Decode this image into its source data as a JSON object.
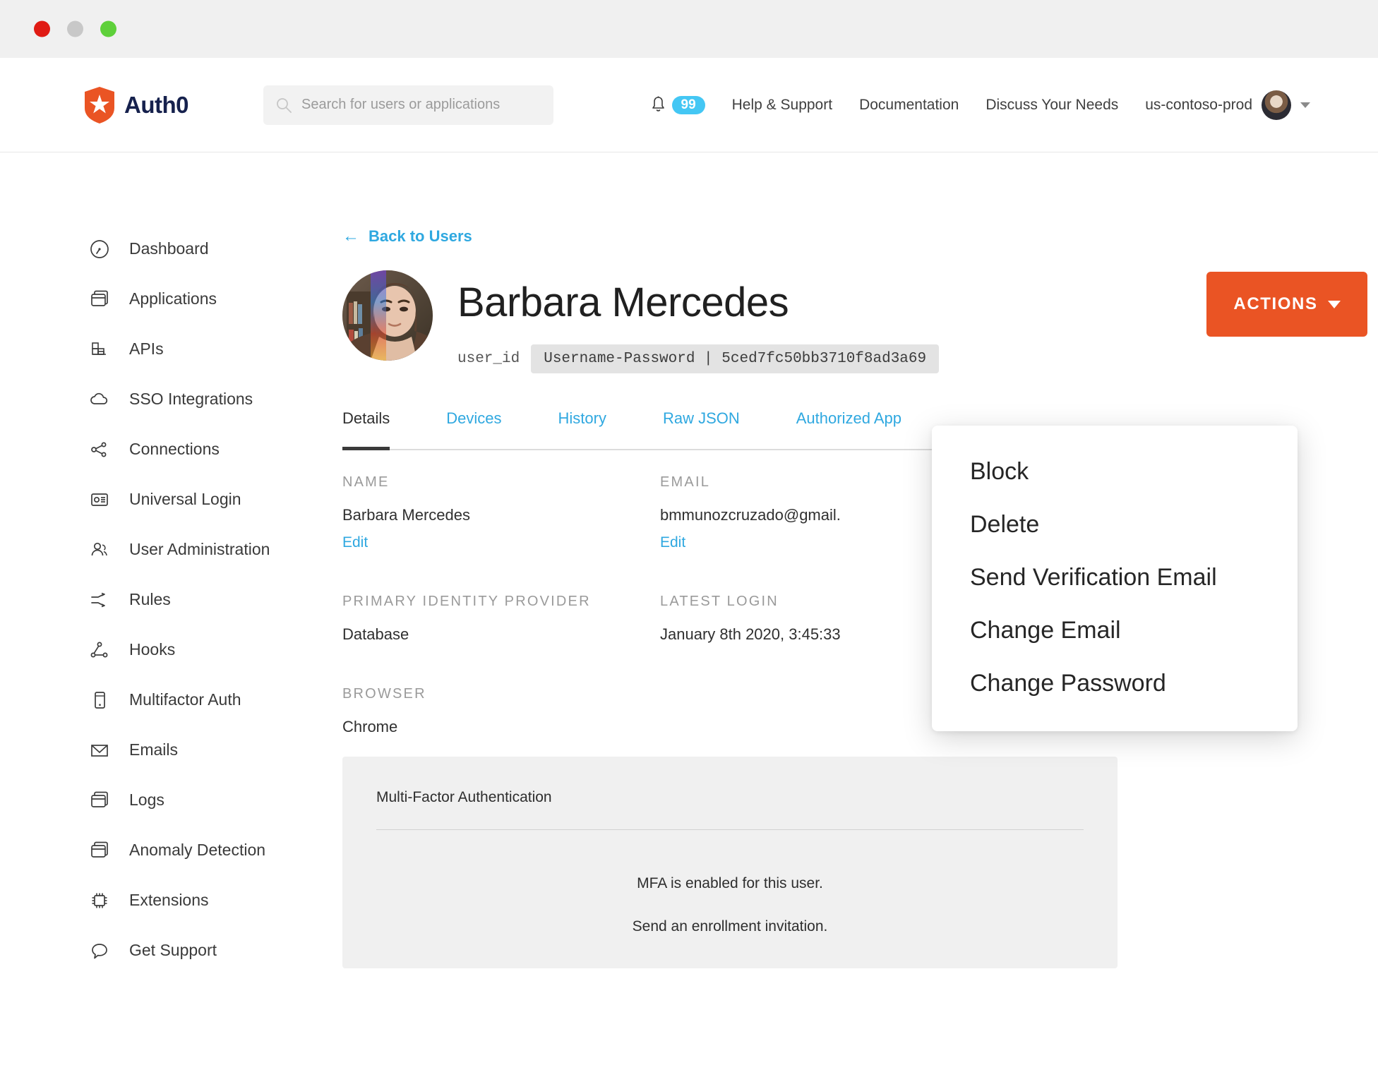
{
  "window": {
    "controls": [
      "close",
      "minimize",
      "maximize"
    ]
  },
  "topnav": {
    "brand": "Auth0",
    "search": {
      "placeholder": "Search for users or applications",
      "value": ""
    },
    "notifications_count": "99",
    "links": [
      {
        "label": "Help & Support",
        "name": "nav-link-help-support"
      },
      {
        "label": "Documentation",
        "name": "nav-link-documentation"
      },
      {
        "label": "Discuss Your Needs",
        "name": "nav-link-discuss-your-needs"
      }
    ],
    "tenant": "us-contoso-prod"
  },
  "sidebar": {
    "items": [
      {
        "label": "Dashboard",
        "icon": "gauge-icon"
      },
      {
        "label": "Applications",
        "icon": "window-stack-icon"
      },
      {
        "label": "APIs",
        "icon": "bar-grid-icon"
      },
      {
        "label": "SSO Integrations",
        "icon": "cloud-icon"
      },
      {
        "label": "Connections",
        "icon": "share-nodes-icon"
      },
      {
        "label": "Universal Login",
        "icon": "id-card-icon"
      },
      {
        "label": "User Administration",
        "icon": "users-icon"
      },
      {
        "label": "Rules",
        "icon": "shuffle-arrows-icon"
      },
      {
        "label": "Hooks",
        "icon": "graph-nodes-icon"
      },
      {
        "label": "Multifactor Auth",
        "icon": "mobile-phone-icon"
      },
      {
        "label": "Emails",
        "icon": "envelope-icon"
      },
      {
        "label": "Logs",
        "icon": "window-stack-icon"
      },
      {
        "label": "Anomaly Detection",
        "icon": "window-stack-icon"
      },
      {
        "label": "Extensions",
        "icon": "chip-icon"
      },
      {
        "label": "Get Support",
        "icon": "speech-bubble-icon"
      }
    ]
  },
  "main": {
    "back_link": "Back to Users",
    "user_name": "Barbara Mercedes",
    "user_id_label": "user_id",
    "user_id_value": "Username-Password  |  5ced7fc50bb3710f8ad3a69",
    "actions_button": "ACTIONS",
    "tabs": [
      {
        "label": "Details",
        "active": true
      },
      {
        "label": "Devices",
        "active": false
      },
      {
        "label": "History",
        "active": false
      },
      {
        "label": "Raw JSON",
        "active": false
      },
      {
        "label": "Authorized App",
        "active": false
      }
    ],
    "fields": [
      {
        "label": "NAME",
        "value": "Barbara Mercedes",
        "edit": "Edit"
      },
      {
        "label": "EMAIL",
        "value": "bmmunozcruzado@gmail.",
        "edit": "Edit"
      },
      {
        "label": "PRIMARY IDENTITY PROVIDER",
        "value": "Database",
        "edit": ""
      },
      {
        "label": "LATEST LOGIN",
        "value": "January 8th 2020, 3:45:33",
        "edit": ""
      },
      {
        "label": "BROWSER",
        "value": "Chrome",
        "edit": ""
      }
    ],
    "mfa": {
      "title": "Multi-Factor Authentication",
      "status": "MFA is enabled for this user.",
      "invite": "Send an enrollment invitation."
    }
  },
  "dropdown": {
    "items": [
      "Block",
      "Delete",
      "Send Verification Email",
      "Change Email",
      "Change Password"
    ]
  },
  "colors": {
    "accent_orange": "#EA5424",
    "link_blue": "#2FA8E0",
    "badge_blue": "#44C7F4",
    "brand_navy": "#16214D"
  }
}
